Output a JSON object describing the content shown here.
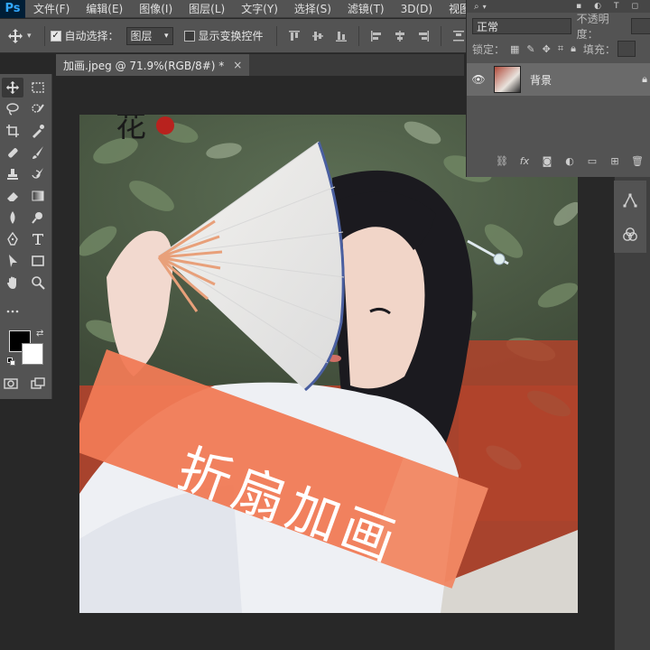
{
  "app": {
    "logo": "Ps"
  },
  "menu": [
    "文件(F)",
    "编辑(E)",
    "图像(I)",
    "图层(L)",
    "文字(Y)",
    "选择(S)",
    "滤镜(T)",
    "3D(D)",
    "视图(V)"
  ],
  "options": {
    "auto_select_label": "自动选择：",
    "auto_select_checked": true,
    "auto_select_target": "图层",
    "show_transform_label": "显示变换控件",
    "show_transform_checked": false
  },
  "document_tab": {
    "title": "加画.jpeg @ 71.9%(RGB/8#) *",
    "close": "×"
  },
  "layers_panel": {
    "blend_mode": "正常",
    "opacity_label": "不透明度：",
    "lock_label": "锁定：",
    "fill_label": "填充：",
    "layer_name": "背景",
    "footer_icons": [
      "link-icon",
      "fx-icon",
      "mask-icon",
      "adjustment-icon",
      "group-icon",
      "new-layer-icon",
      "delete-icon"
    ],
    "footer_labels": {
      "fx": "fx"
    }
  },
  "canvas": {
    "banner_text": "折扇加画",
    "banner_color": "#f07a55",
    "stamp_text": "花"
  },
  "colors": {
    "chrome": "#535353",
    "workspace": "#282828",
    "foreground": "#000000",
    "background": "#ffffff"
  }
}
